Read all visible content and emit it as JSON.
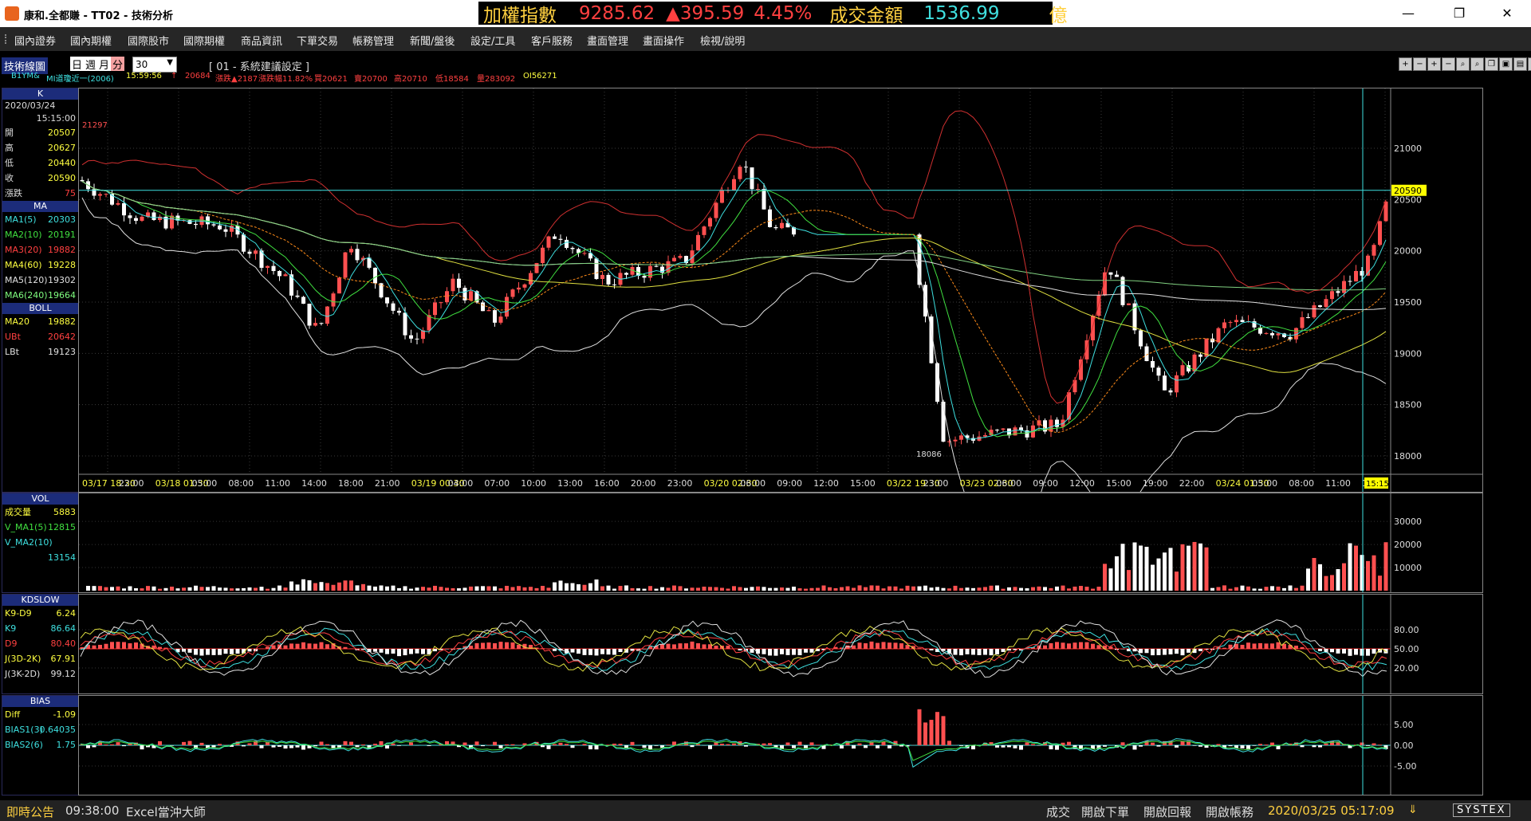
{
  "window": {
    "title": "康和.全都賺 - TT02 - 技術分析"
  },
  "ticker": {
    "index_label": "加權指數",
    "index_value": "9285.62",
    "change": "▲395.59",
    "change_pct": "4.45%",
    "turnover_label": "成交金額",
    "turnover_value": "1536.99",
    "unit": "億"
  },
  "menu": [
    "國內證券",
    "國內期權",
    "國際股市",
    "國際期權",
    "商品資訊",
    "下單交易",
    "帳務管理",
    "新聞/盤後",
    "設定/工具",
    "客戶服務",
    "畫面管理",
    "畫面操作",
    "檢視/說明"
  ],
  "toolbar": {
    "chart_label": "技術線圖",
    "periods": [
      "日",
      "週",
      "月",
      "分"
    ],
    "active_period": "分",
    "interval": "30",
    "settings_title": "[ 01 - 系統建議設定 ]"
  },
  "infobar": {
    "symbol": "B1YM&",
    "name": "MI道瓊近一(2006)",
    "time": "15:59:56",
    "last_arrow": "↑",
    "last": "20684",
    "chg": "漲跌▲2187",
    "chg_pct": "漲跌幅11.82%",
    "bid": "買20621",
    "ask": "賣20700",
    "high": "高20710",
    "low": "低18584",
    "vol": "量283092",
    "oi": "OI56271"
  },
  "panel_k": {
    "head": "K",
    "date": "2020/03/24",
    "time": "15:15:00",
    "rows": [
      {
        "label": "開",
        "value": "20507"
      },
      {
        "label": "高",
        "value": "20627"
      },
      {
        "label": "低",
        "value": "20440"
      },
      {
        "label": "收",
        "value": "20590"
      },
      {
        "label": "漲跌",
        "value": "75"
      }
    ]
  },
  "panel_ma": {
    "head": "MA",
    "rows": [
      {
        "label": "MA1(5)",
        "value": "20303",
        "color": "#3ee0e0"
      },
      {
        "label": "MA2(10)",
        "value": "20191",
        "color": "#40e040"
      },
      {
        "label": "MA3(20)",
        "value": "19882",
        "color": "#ff4040"
      },
      {
        "label": "MA4(60)",
        "value": "19228",
        "color": "#ffff40"
      },
      {
        "label": "MA5(120)",
        "value": "19302",
        "color": "#e0e0e0"
      },
      {
        "label": "MA6(240)",
        "value": "19664",
        "color": "#80ff80"
      }
    ]
  },
  "panel_boll": {
    "head": "BOLL",
    "rows": [
      {
        "label": "MA20",
        "value": "19882",
        "color": "#ffff40"
      },
      {
        "label": "UBt",
        "value": "20642",
        "color": "#ff4040"
      },
      {
        "label": "LBt",
        "value": "19123",
        "color": "#e0e0e0"
      }
    ]
  },
  "panel_vol": {
    "head": "VOL",
    "rows": [
      {
        "label": "成交量",
        "value": "5883",
        "color": "#ffff40"
      },
      {
        "label": "V_MA1(5)",
        "value": "12815",
        "color": "#40e040"
      },
      {
        "label": "V_MA2(10)",
        "value": "",
        "color": "#3ee0e0"
      },
      {
        "label": "",
        "value": "13154",
        "color": "#3ee0e0"
      }
    ]
  },
  "panel_kd": {
    "head": "KDSLOW",
    "rows": [
      {
        "label": "K9-D9",
        "value": "6.24",
        "color": "#ffff40"
      },
      {
        "label": "K9",
        "value": "86.64",
        "color": "#3ee0e0"
      },
      {
        "label": "D9",
        "value": "80.40",
        "color": "#ff4040"
      },
      {
        "label": "J(3D-2K)",
        "value": "67.91",
        "color": "#ffff40"
      },
      {
        "label": "J(3K-2D)",
        "value": "99.12",
        "color": "#e0e0e0"
      }
    ]
  },
  "panel_bias": {
    "head": "BIAS",
    "rows": [
      {
        "label": "Diff",
        "value": "-1.09",
        "color": "#ffff40"
      },
      {
        "label": "BIAS1(3)",
        "value": "0.64035",
        "color": "#3ee0e0"
      },
      {
        "label": "BIAS2(6)",
        "value": "1.75",
        "color": "#3ee0e0"
      }
    ]
  },
  "main_chart": {
    "price_ticks": [
      "21000",
      "20500",
      "20000",
      "19500",
      "19000",
      "18500",
      "18000"
    ],
    "last_price_label": "20590",
    "high_marker": "21297",
    "low_marker": "18086",
    "time_labels": [
      "03/17 18:30",
      "22:00",
      "03/18 01:30",
      "05:00",
      "08:00",
      "11:00",
      "14:00",
      "18:00",
      "21:00",
      "03/19 00:30",
      "04:00",
      "07:00",
      "10:00",
      "13:00",
      "16:00",
      "20:00",
      "23:00",
      "03/20 02:30",
      "06:00",
      "09:00",
      "12:00",
      "15:00",
      "03/22 19:30",
      "23:00",
      "03/23 02:30",
      "06:00",
      "09:00",
      "12:00",
      "15:00",
      "19:00",
      "22:00",
      "03/24 01:30",
      "05:00",
      "08:00",
      "11:00",
      "14:00"
    ],
    "cursor_time": "15:15"
  },
  "vol_chart": {
    "ticks": [
      "30000",
      "20000",
      "10000"
    ]
  },
  "kd_chart": {
    "ticks": [
      "80.00",
      "50.00",
      "20.00"
    ]
  },
  "bias_chart": {
    "ticks": [
      "5.00",
      "0.00",
      "-5.00"
    ]
  },
  "status": {
    "news_label": "即時公告",
    "news_time": "09:38:00",
    "news_text": "Excel當沖大師",
    "btns": [
      "成交",
      "開啟下單",
      "開啟回報",
      "開啟帳務"
    ],
    "datetime": "2020/03/25 05:17:09",
    "brand": "SYSTEX"
  }
}
